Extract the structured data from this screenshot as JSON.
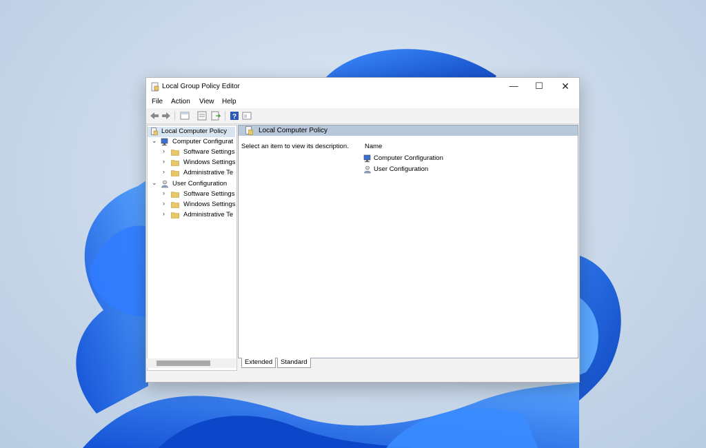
{
  "window": {
    "title": "Local Group Policy Editor",
    "controls": {
      "minimize": "—",
      "maximize": "☐",
      "close": "✕"
    }
  },
  "menu": [
    "File",
    "Action",
    "View",
    "Help"
  ],
  "toolbar": [
    "back-icon",
    "forward-icon",
    "up-folder-icon",
    "show-hide-tree-icon",
    "export-list-icon",
    "help-icon",
    "properties-icon"
  ],
  "tree": {
    "root": "Local Computer Policy",
    "items": [
      {
        "label": "Computer Configurat",
        "level": 1,
        "expanded": true
      },
      {
        "label": "Software Settings",
        "level": 2
      },
      {
        "label": "Windows Settings",
        "level": 2
      },
      {
        "label": "Administrative Te",
        "level": 2
      },
      {
        "label": "User Configuration",
        "level": 1,
        "expanded": true
      },
      {
        "label": "Software Settings",
        "level": 2
      },
      {
        "label": "Windows Settings",
        "level": 2
      },
      {
        "label": "Administrative Te",
        "level": 2
      }
    ]
  },
  "details": {
    "header": "Local Computer Policy",
    "description": "Select an item to view its description.",
    "column_name": "Name",
    "rows": [
      "Computer Configuration",
      "User Configuration"
    ]
  },
  "tabs": [
    "Extended",
    "Standard"
  ],
  "colors": {
    "accent_blue": "#1f5fd6",
    "header_bg": "#b8c7d9",
    "folder": "#e8c766"
  }
}
